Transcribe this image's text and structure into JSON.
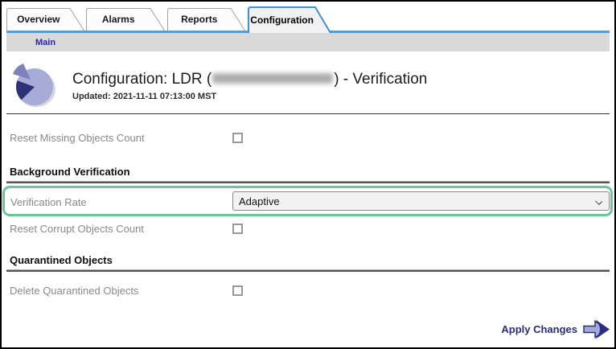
{
  "tabs": [
    {
      "label": "Overview",
      "active": false
    },
    {
      "label": "Alarms",
      "active": false
    },
    {
      "label": "Reports",
      "active": false
    },
    {
      "label": "Configuration",
      "active": true
    }
  ],
  "breadcrumb": {
    "main": "Main"
  },
  "header": {
    "title_prefix": "Configuration: LDR (",
    "title_suffix": ") - Verification",
    "node_name_redacted": true,
    "updated": "Updated: 2021-11-11 07:13:00 MST"
  },
  "sections": {
    "background_verification": "Background Verification",
    "quarantined_objects": "Quarantined Objects"
  },
  "fields": {
    "reset_missing": {
      "label": "Reset Missing Objects Count",
      "type": "checkbox",
      "checked": false
    },
    "verification_rate": {
      "label": "Verification Rate",
      "type": "select",
      "value": "Adaptive"
    },
    "reset_corrupt": {
      "label": "Reset Corrupt Objects Count",
      "type": "checkbox",
      "checked": false
    },
    "delete_quarantined": {
      "label": "Delete Quarantined Objects",
      "type": "checkbox",
      "checked": false
    }
  },
  "footer": {
    "apply": "Apply Changes"
  },
  "icons": [
    "pie-chart-icon",
    "chevron-down-icon",
    "apply-changes-arrow-icon"
  ],
  "colors": {
    "highlight_green": "#6bc795",
    "active_tab_blue": "#4191d6",
    "tab_underline_blue": "#5b9bd5",
    "breadcrumb_bar_gray": "#d9d9d9",
    "link_blue": "#2424cf",
    "label_gray": "#8a8a8a",
    "apply_navy": "#272c7f"
  }
}
